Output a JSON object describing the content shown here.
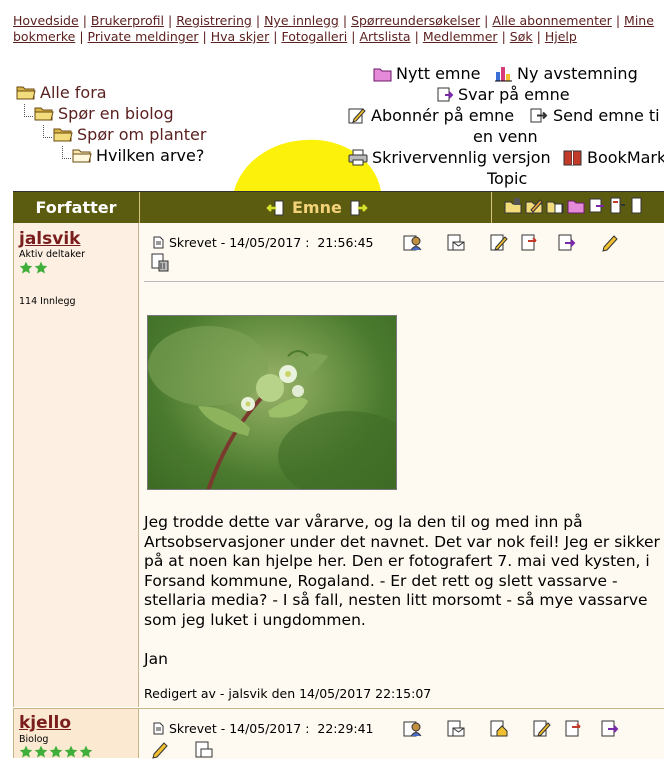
{
  "topnav": {
    "links": [
      "Hovedside",
      "Brukerprofil",
      "Registrering",
      "Nye innlegg",
      "Spørreundersøkelser",
      "Alle abonnementer",
      "Mine bokmerke",
      "Private meldinger",
      "Hva skjer",
      "Fotogalleri",
      "Artslista",
      "Medlemmer",
      "Søk",
      "Hjelp"
    ]
  },
  "tree": {
    "root": "Alle fora",
    "level1": "Spør en biolog",
    "level2": "Spør om planter",
    "current": "Hvilken arve?"
  },
  "actions": {
    "new_topic": "Nytt emne",
    "new_poll": "Ny avstemning",
    "reply": "Svar på emne",
    "subscribe": "Abonnér på emne",
    "send_friend_1": "Send emne ti",
    "send_friend_2": "en venn",
    "printer": "Skrivervennlig versjon",
    "bookmark_1": "BookMark",
    "bookmark_2": "Topic"
  },
  "table": {
    "author_header": "Forfatter",
    "topic_header": "Emne"
  },
  "posts": [
    {
      "username": "jalsvik",
      "rank": "Aktiv deltaker",
      "stars": 2,
      "post_count": "114 Innlegg",
      "written_label": "Skrevet",
      "date": "14/05/2017",
      "time": "21:56:45",
      "body": [
        "Jeg trodde dette var vårarve, og la den til og med inn på Artsobservasjoner under det navnet. Det var nok feil! Jeg er sikker på at noen kan hjelpe her. Den er fotografert 7. mai ved kysten, i Forsand kommune, Rogaland. - Er det rett og slett vassarve - stellaria media? - I så fall, nesten litt morsomt - så mye vassarve som jeg luket i ungdommen.",
        "Jan"
      ],
      "edited": "Redigert av - jalsvik den 14/05/2017 22:15:07"
    },
    {
      "username": "kjello",
      "rank": "Biolog",
      "stars": 5,
      "written_label": "Skrevet",
      "date": "14/05/2017",
      "time": "22:29:41"
    }
  ],
  "colors": {
    "header_bg": "#5c5c10",
    "header_topic_text": "#f3d27a",
    "link": "#5a1f1f",
    "highlight": "#fcf10a",
    "star": "#3fae3a"
  }
}
